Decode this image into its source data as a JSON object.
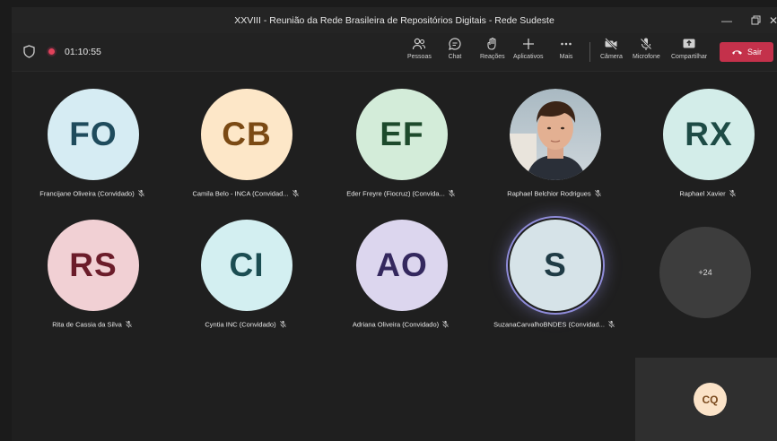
{
  "window": {
    "title": "XXVIII - Reunião da Rede Brasileira de Repositórios Digitais - Rede Sudeste"
  },
  "toolbar": {
    "timer": "01:10:55",
    "people": "Pessoas",
    "chat": "Chat",
    "reactions": "Reações",
    "apps": "Aplicativos",
    "more": "Mais",
    "camera": "Câmera",
    "mic": "Microfone",
    "share": "Compartilhar",
    "leave": "Sair"
  },
  "participants": [
    {
      "initials": "FO",
      "name": "Francijane Oliveira (Convidado)",
      "bg": "#d6ecf3",
      "fg": "#1f4b5c"
    },
    {
      "initials": "CB",
      "name": "Camila Belo - INCA (Convidad...",
      "bg": "#fde7c8",
      "fg": "#7b4a14"
    },
    {
      "initials": "EF",
      "name": "Eder Freyre (Fiocruz) (Convida...",
      "bg": "#d3ecd9",
      "fg": "#1d4a2c"
    },
    {
      "initials": "",
      "name": "Raphael Belchior Rodrigues",
      "photo": true
    },
    {
      "initials": "RX",
      "name": "Raphael Xavier",
      "bg": "#d3ede9",
      "fg": "#1d4b45"
    },
    {
      "initials": "RS",
      "name": "Rita de Cassia da Silva",
      "bg": "#f1d0d4",
      "fg": "#6b1c2a"
    },
    {
      "initials": "CI",
      "name": "Cyntia INC (Convidado)",
      "bg": "#d3eff1",
      "fg": "#1b4d52"
    },
    {
      "initials": "AO",
      "name": "Adriana Oliveira (Convidado)",
      "bg": "#dcd6ee",
      "fg": "#34285e"
    },
    {
      "initials": "S",
      "name": "SuzanaCarvalhoBNDES (Convidad...",
      "bg": "#d6e3e8",
      "fg": "#1f3b45",
      "speaking": true
    }
  ],
  "overflow": {
    "count": "+24"
  },
  "self": {
    "initials": "CQ"
  }
}
